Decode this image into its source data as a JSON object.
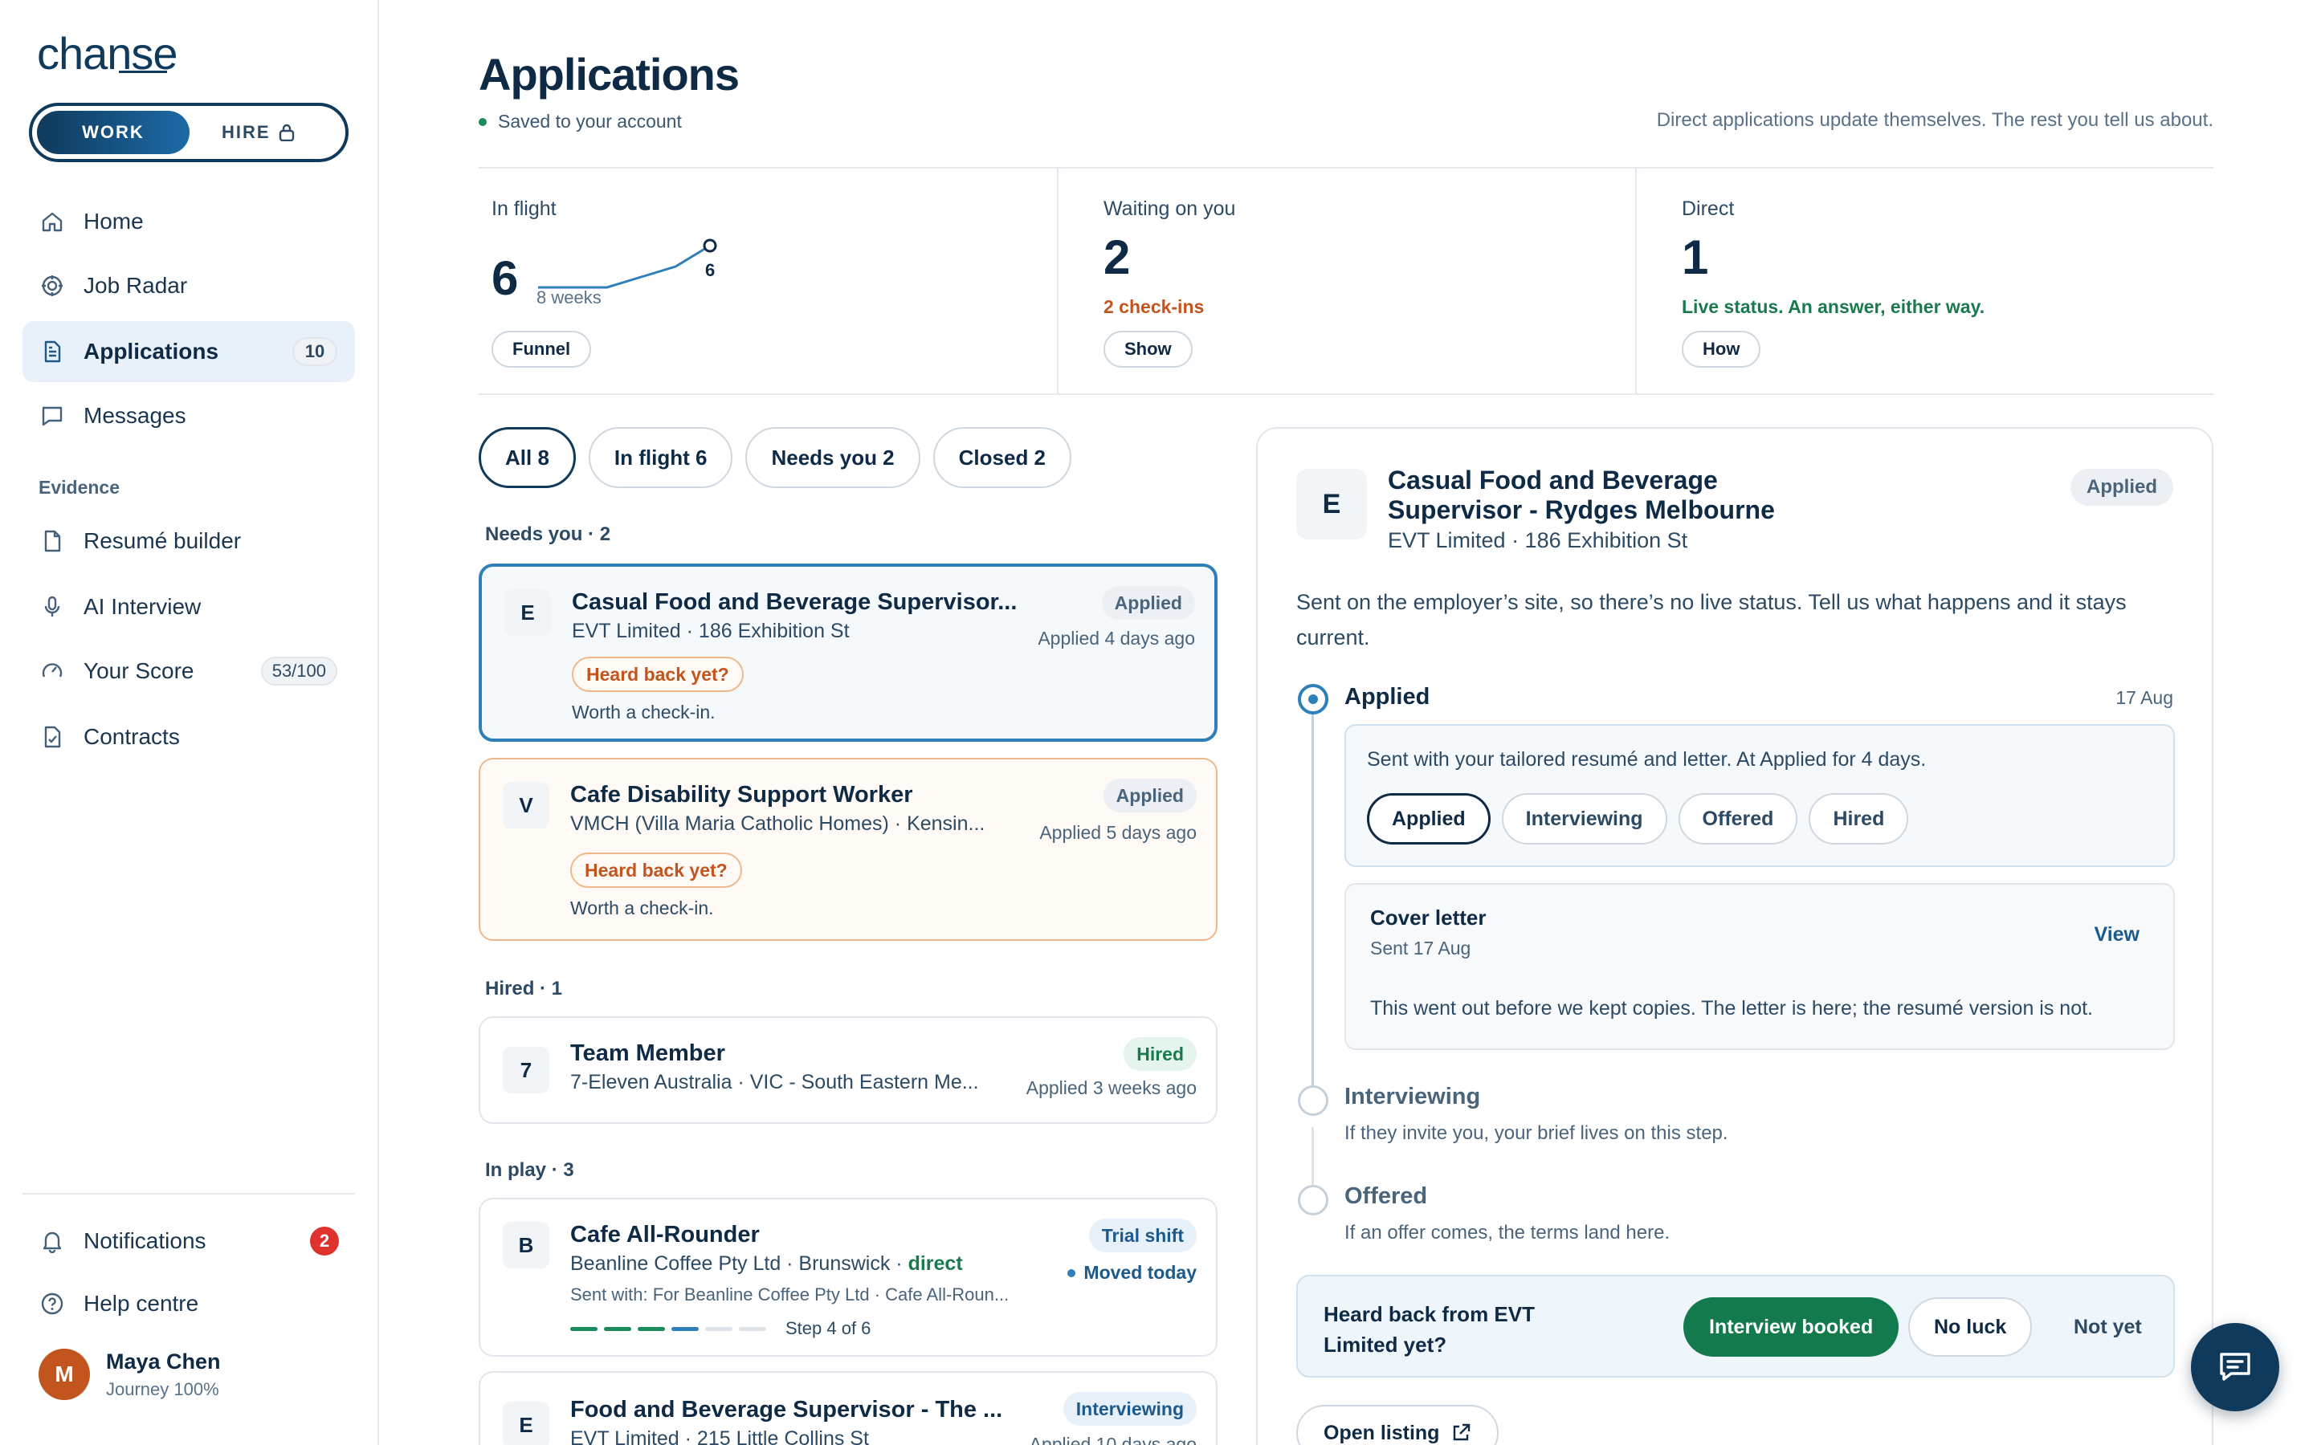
{
  "app": {
    "logo": "chanse",
    "mode": {
      "work": "WORK",
      "hire": "HIRE"
    }
  },
  "sidebar": {
    "items": [
      {
        "label": "Home",
        "icon": "home-icon"
      },
      {
        "label": "Job Radar",
        "icon": "radar-icon"
      },
      {
        "label": "Applications",
        "icon": "document-icon",
        "count": "10",
        "active": true
      },
      {
        "label": "Messages",
        "icon": "message-icon"
      }
    ],
    "evidence_label": "Evidence",
    "evidence_items": [
      {
        "label": "Resumé builder",
        "icon": "file-icon"
      },
      {
        "label": "AI Interview",
        "icon": "microphone-icon"
      },
      {
        "label": "Your Score",
        "icon": "gauge-icon",
        "count": "53/100"
      },
      {
        "label": "Contracts",
        "icon": "contract-icon"
      }
    ],
    "notifications": {
      "label": "Notifications",
      "count": "2"
    },
    "help": {
      "label": "Help centre"
    },
    "user": {
      "initial": "M",
      "name": "Maya Chen",
      "sub": "Journey 100%"
    }
  },
  "header": {
    "title": "Applications",
    "saved": "Saved to your account",
    "tagline": "Direct applications update themselves. The rest you tell us about."
  },
  "stats": [
    {
      "label": "In flight",
      "value": "6",
      "spark_end": "6",
      "spark_sub": "8 weeks",
      "spark_values": [
        0,
        0,
        0,
        1,
        2,
        4
      ],
      "button": "Funnel"
    },
    {
      "label": "Waiting on you",
      "value": "2",
      "note": "2 check-ins",
      "button": "Show",
      "note_color": "#c2541d"
    },
    {
      "label": "Direct",
      "value": "1",
      "note": "Live status. An answer, either way.",
      "button": "How",
      "note_color": "#1a7a4e"
    }
  ],
  "filters": [
    "All 8",
    "In flight 6",
    "Needs you 2",
    "Closed 2"
  ],
  "groups": {
    "needs_you": "Needs you · 2",
    "hired": "Hired · 1",
    "in_play": "In play · 3"
  },
  "cards": [
    {
      "letter": "E",
      "title": "Casual Food and Beverage Supervisor...",
      "sub": "EVT Limited · 186 Exhibition St",
      "status": "Applied",
      "when": "Applied 4 days ago",
      "heard": "Heard back yet?",
      "worth": "Worth a check-in."
    },
    {
      "letter": "V",
      "title": "Cafe Disability Support Worker",
      "sub": "VMCH (Villa Maria Catholic Homes) · Kensin...",
      "status": "Applied",
      "when": "Applied 5 days ago",
      "heard": "Heard back yet?",
      "worth": "Worth a check-in."
    },
    {
      "letter": "7",
      "title": "Team Member",
      "sub": "7-Eleven Australia · VIC - South Eastern Me...",
      "status": "Hired",
      "when": "Applied 3 weeks ago"
    },
    {
      "letter": "B",
      "title": "Cafe All-Rounder",
      "sub": "Beanline Coffee Pty Ltd · Brunswick · ",
      "direct": "direct",
      "status": "Trial shift",
      "moved": "Moved today",
      "sent_with": "Sent with: For Beanline Coffee Pty Ltd · Cafe All-Roun...",
      "step": "Step 4 of 6",
      "step_current": 4,
      "step_total": 6
    },
    {
      "letter": "E",
      "title": "Food and Beverage Supervisor - The ...",
      "sub": "EVT Limited · 215 Little Collins St",
      "status": "Interviewing",
      "when": "Applied 10 days ago"
    }
  ],
  "detail": {
    "letter": "E",
    "title": "Casual Food and Beverage Supervisor - Rydges Melbourne",
    "sub": "EVT Limited · 186 Exhibition St",
    "status": "Applied",
    "intro": "Sent on the employer’s site, so there’s no live status. Tell us what happens and it stays current.",
    "timeline": [
      {
        "name": "Applied",
        "date": "17 Aug"
      },
      {
        "name": "Interviewing",
        "note": "If they invite you, your brief lives on this step."
      },
      {
        "name": "Offered",
        "note": "If an offer comes, the terms land here."
      }
    ],
    "stage_msg": "Sent with your tailored resumé and letter. At Applied for 4 days.",
    "stage_pills": [
      "Applied",
      "Interviewing",
      "Offered",
      "Hired"
    ],
    "cover": {
      "title": "Cover letter",
      "sent": "Sent 17 Aug",
      "view": "View",
      "note": "This went out before we kept copies. The letter is here; the resumé version is not."
    },
    "heard": {
      "question": "Heard back from EVT Limited yet?",
      "booked": "Interview booked",
      "no_luck": "No luck",
      "not_yet": "Not yet"
    },
    "open_listing": "Open listing"
  }
}
